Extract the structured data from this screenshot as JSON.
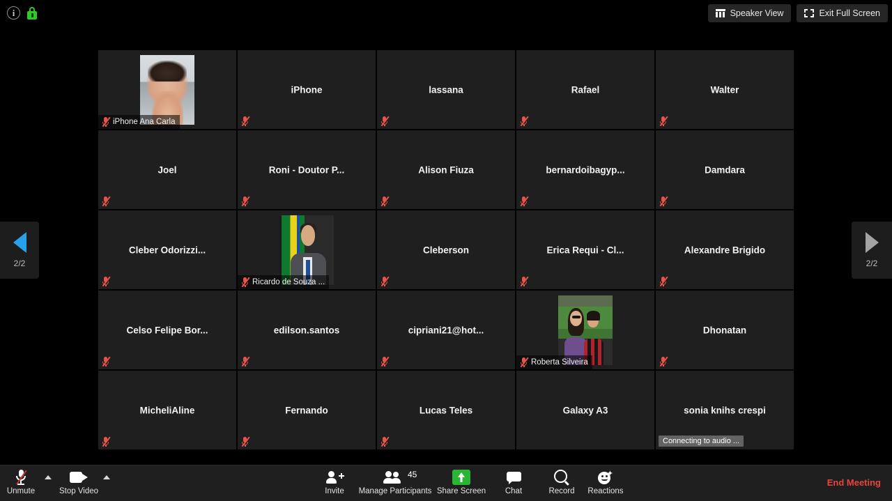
{
  "topbar": {
    "info_icon": "info-icon",
    "lock_icon": "lock-icon",
    "speaker_view_label": "Speaker View",
    "exit_full_screen_label": "Exit Full Screen"
  },
  "pager": {
    "prev_count": "2/2",
    "next_count": "2/2"
  },
  "gallery": {
    "participants": [
      {
        "name": "iPhone Ana Carla",
        "video": "ana",
        "muted": true,
        "name_position": "strip"
      },
      {
        "name": "iPhone",
        "video": null,
        "muted": true,
        "name_position": "center"
      },
      {
        "name": "lassana",
        "video": null,
        "muted": true,
        "name_position": "center"
      },
      {
        "name": "Rafael",
        "video": null,
        "muted": true,
        "name_position": "center"
      },
      {
        "name": "Walter",
        "video": null,
        "muted": true,
        "name_position": "center"
      },
      {
        "name": "Joel",
        "video": null,
        "muted": true,
        "name_position": "center"
      },
      {
        "name": "Roni - Doutor P...",
        "video": null,
        "muted": true,
        "name_position": "center"
      },
      {
        "name": "Alison Fiuza",
        "video": null,
        "muted": true,
        "name_position": "center"
      },
      {
        "name": "bernardoibagyp...",
        "video": null,
        "muted": true,
        "name_position": "center"
      },
      {
        "name": "Damdara",
        "video": null,
        "muted": true,
        "name_position": "center"
      },
      {
        "name": "Cleber  Odorizzi...",
        "video": null,
        "muted": true,
        "name_position": "center"
      },
      {
        "name": "Ricardo de Souza ...",
        "video": "ricardo",
        "muted": true,
        "name_position": "strip"
      },
      {
        "name": "Cleberson",
        "video": null,
        "muted": true,
        "name_position": "center"
      },
      {
        "name": "Erica Requi - Cl...",
        "video": null,
        "muted": true,
        "name_position": "center"
      },
      {
        "name": "Alexandre Brigido",
        "video": null,
        "muted": true,
        "name_position": "center"
      },
      {
        "name": "Celso  Felipe  Bor...",
        "video": null,
        "muted": true,
        "name_position": "center"
      },
      {
        "name": "edilson.santos",
        "video": null,
        "muted": true,
        "name_position": "center"
      },
      {
        "name": "cipriani21@hot...",
        "video": null,
        "muted": true,
        "name_position": "center"
      },
      {
        "name": "Roberta Silveira",
        "video": "roberta",
        "muted": true,
        "name_position": "strip"
      },
      {
        "name": "Dhonatan",
        "video": null,
        "muted": true,
        "name_position": "center"
      },
      {
        "name": "MicheliAline",
        "video": null,
        "muted": true,
        "name_position": "center"
      },
      {
        "name": "Fernando",
        "video": null,
        "muted": true,
        "name_position": "center"
      },
      {
        "name": "Lucas Teles",
        "video": null,
        "muted": true,
        "name_position": "center"
      },
      {
        "name": "Galaxy A3",
        "video": null,
        "muted": false,
        "name_position": "center"
      },
      {
        "name": "sonia knihs crespi",
        "video": null,
        "muted": false,
        "name_position": "center",
        "status": "Connecting to audio ..."
      }
    ]
  },
  "toolbar": {
    "unmute_label": "Unmute",
    "stop_video_label": "Stop Video",
    "invite_label": "Invite",
    "manage_participants_label": "Manage Participants",
    "participants_count": "45",
    "share_screen_label": "Share Screen",
    "chat_label": "Chat",
    "record_label": "Record",
    "reactions_label": "Reactions",
    "end_meeting_label": "End Meeting"
  },
  "colors": {
    "accent_blue": "#27a1e8",
    "share_green": "#2bb534",
    "lock_green": "#2ecc22",
    "mute_red": "#e8544a",
    "end_red": "#e8443b",
    "tile_bg": "#1f1f1f",
    "toolbar_bg": "#1f1f1f"
  }
}
